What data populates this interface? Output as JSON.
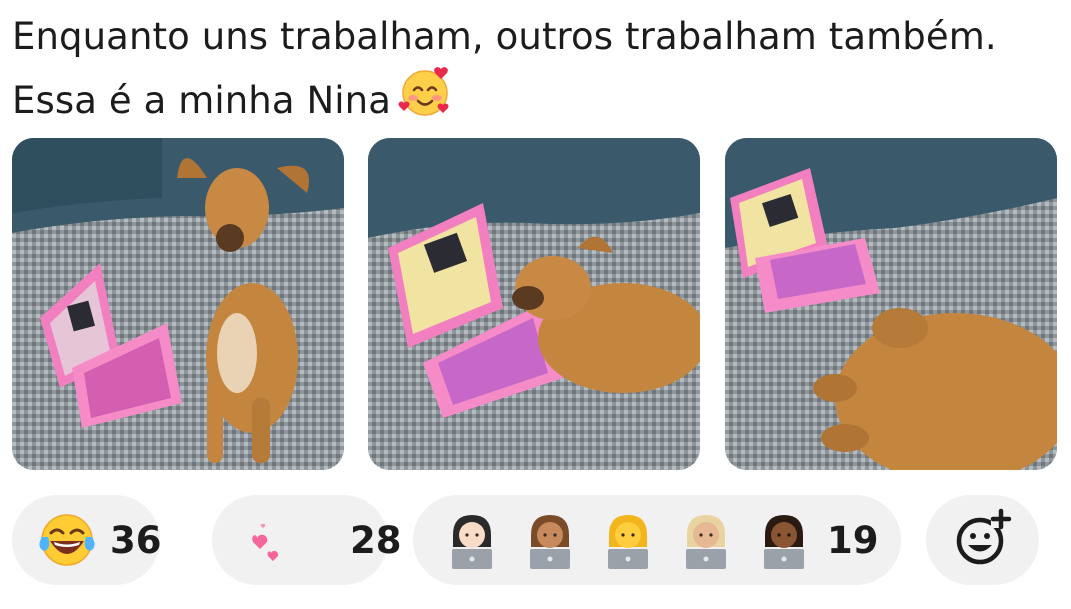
{
  "post": {
    "line1": "Enquanto uns trabalham, outros trabalham também.",
    "line2": "Essa é a minha Nina",
    "line2_emoji": "smiling-face-with-hearts"
  },
  "photos": [
    {
      "label": "dog-sitting-beside-pink-toy-laptop"
    },
    {
      "label": "dog-nose-on-pink-toy-laptop"
    },
    {
      "label": "dog-sleeping-near-pink-toy-laptop"
    }
  ],
  "reactions": {
    "joy": {
      "icon": "face-with-tears-of-joy",
      "count": "36"
    },
    "hearts": {
      "icon": "two-hearts",
      "count": "28"
    },
    "workers": {
      "icons": [
        "woman-technologist-light",
        "woman-technologist-medium",
        "woman-technologist",
        "woman-technologist-medium-light",
        "woman-technologist-dark"
      ],
      "count": "19"
    },
    "add": {
      "icon": "add-reaction"
    }
  },
  "colors": {
    "pill_bg": "#f1f1f1",
    "text": "#1d1c1d",
    "laptop_pink": "#f27fc0",
    "dog_brown": "#c4853f",
    "couch_blue": "#3a5a6b",
    "blanket_gray": "#8e969c"
  }
}
